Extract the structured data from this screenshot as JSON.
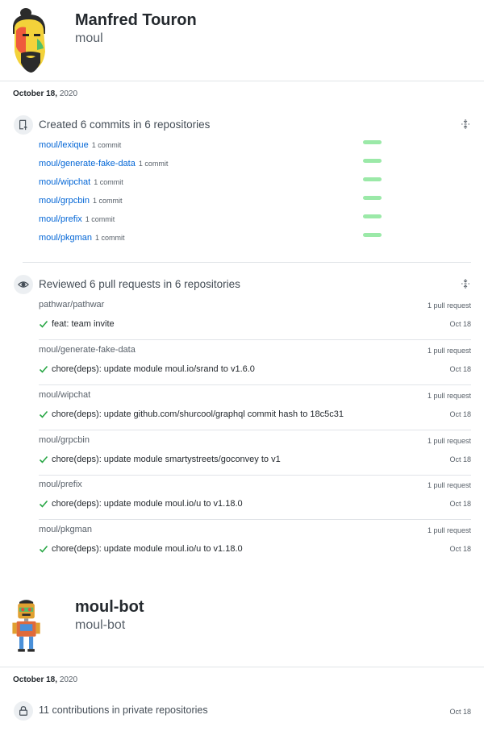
{
  "users": [
    {
      "name": "Manfred Touron",
      "login": "moul",
      "date": {
        "bold": "October 18,",
        "year": "2020"
      },
      "commits": {
        "title": "Created 6 commits in 6 repositories",
        "items": [
          {
            "repo": "moul/lexique",
            "count": "1 commit"
          },
          {
            "repo": "moul/generate-fake-data",
            "count": "1 commit"
          },
          {
            "repo": "moul/wipchat",
            "count": "1 commit"
          },
          {
            "repo": "moul/grpcbin",
            "count": "1 commit"
          },
          {
            "repo": "moul/prefix",
            "count": "1 commit"
          },
          {
            "repo": "moul/pkgman",
            "count": "1 commit"
          }
        ]
      },
      "reviews": {
        "title": "Reviewed 6 pull requests in 6 repositories",
        "items": [
          {
            "repo": "pathwar/pathwar",
            "count": "1 pull request",
            "title": "feat: team invite",
            "date": "Oct 18"
          },
          {
            "repo": "moul/generate-fake-data",
            "count": "1 pull request",
            "title": "chore(deps): update module moul.io/srand to v1.6.0",
            "date": "Oct 18"
          },
          {
            "repo": "moul/wipchat",
            "count": "1 pull request",
            "title": "chore(deps): update github.com/shurcool/graphql commit hash to 18c5c31",
            "date": "Oct 18"
          },
          {
            "repo": "moul/grpcbin",
            "count": "1 pull request",
            "title": "chore(deps): update module smartystreets/goconvey to v1",
            "date": "Oct 18"
          },
          {
            "repo": "moul/prefix",
            "count": "1 pull request",
            "title": "chore(deps): update module moul.io/u to v1.18.0",
            "date": "Oct 18"
          },
          {
            "repo": "moul/pkgman",
            "count": "1 pull request",
            "title": "chore(deps): update module moul.io/u to v1.18.0",
            "date": "Oct 18"
          }
        ]
      }
    },
    {
      "name": "moul-bot",
      "login": "moul-bot",
      "date": {
        "bold": "October 18,",
        "year": "2020"
      },
      "private": {
        "text": "11 contributions in private repositories",
        "date": "Oct 18"
      }
    }
  ],
  "icons": [
    "push-icon",
    "eye-icon",
    "fold-icon",
    "check-icon",
    "lock-icon"
  ],
  "colors": {
    "link": "#0366d6",
    "bar": "#9be9a8",
    "check": "#28a745",
    "muted": "#586069"
  }
}
